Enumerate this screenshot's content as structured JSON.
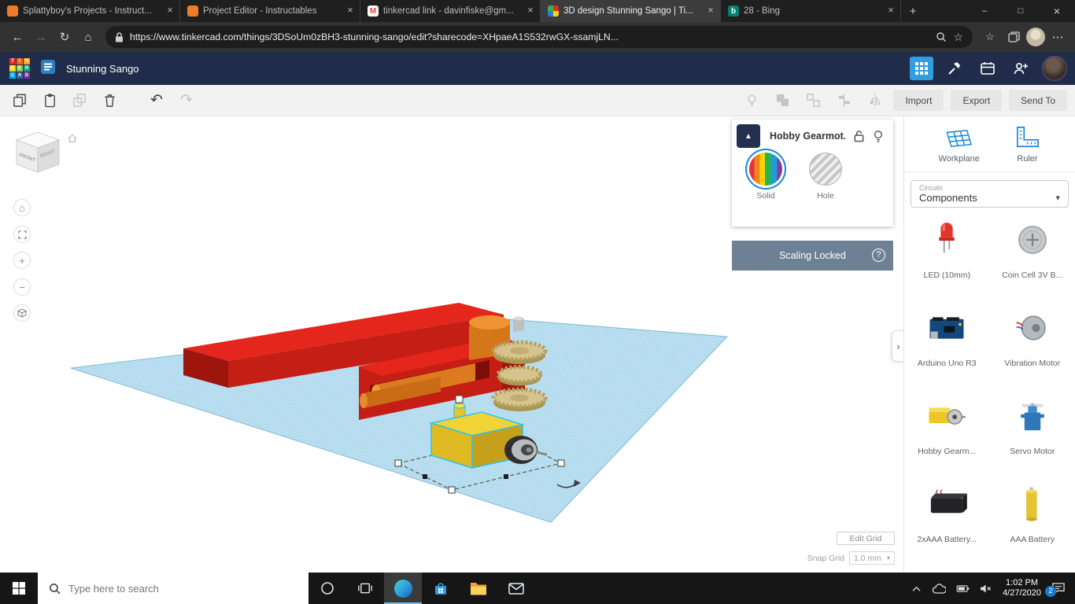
{
  "colors": {
    "accent_blue": "#1789d6",
    "selection_cyan": "#29c3f2",
    "workplane_blue": "#badff0",
    "shape_red": "#e5261c",
    "navbar_navy": "#202c49"
  },
  "browser": {
    "tabs": [
      {
        "title": "Splattyboy's Projects - Instruct..."
      },
      {
        "title": "Project Editor - Instructables"
      },
      {
        "title": "tinkercad link - davinfiske@gm..."
      },
      {
        "title": "3D design Stunning Sango | Ti..."
      },
      {
        "title": "28 - Bing"
      }
    ],
    "url": "https://www.tinkercad.com/things/3DSoUm0zBH3-stunning-sango/edit?sharecode=XHpaeA1S532rwGX-ssamjLN...",
    "glyphs": {
      "tab_close": "×",
      "new_tab": "+",
      "minimize": "–",
      "maximize": "□",
      "close": "×",
      "back": "←",
      "forward": "→",
      "refresh": "↻",
      "home": "⌂",
      "star": "☆",
      "menu": "⋯",
      "gmail_m": "M",
      "bing_b": "b"
    }
  },
  "app": {
    "logo_letters": [
      "T",
      "I",
      "N",
      "K",
      "E",
      "R",
      "C",
      "A",
      "D"
    ],
    "title": "Stunning Sango",
    "toolbar": {
      "import": "Import",
      "export": "Export",
      "send_to": "Send To"
    },
    "toolbar_glyphs": {
      "undo": "↶",
      "redo": "↷"
    },
    "viewcube": {
      "front": "FRONT",
      "right": "RIGHT"
    },
    "view_glyphs": {
      "home": "⌂",
      "zoom_in": "+",
      "zoom_out": "−"
    },
    "inspector": {
      "collapse": "▲",
      "title": "Hobby Gearmot...",
      "solid": "Solid",
      "hole": "Hole",
      "scaling": "Scaling Locked",
      "help": "?"
    },
    "panel_chevron": "›",
    "sidebar": {
      "workplane": "Workplane",
      "ruler": "Ruler",
      "category_group": "Circuits",
      "category": "Components",
      "caret": "▾",
      "components": [
        {
          "name": "LED (10mm)"
        },
        {
          "name": "Coin Cell 3V B..."
        },
        {
          "name": "Arduino Uno R3"
        },
        {
          "name": "Vibration Motor"
        },
        {
          "name": "Hobby Gearm..."
        },
        {
          "name": "Servo Motor"
        },
        {
          "name": "2xAAA Battery..."
        },
        {
          "name": "AAA Battery"
        }
      ]
    },
    "grid_footer": {
      "edit": "Edit Grid",
      "snap_label": "Snap Grid",
      "snap_value": "1.0 mm",
      "caret": "▾"
    }
  },
  "taskbar": {
    "search_placeholder": "Type here to search",
    "time": "1:02 PM",
    "date": "4/27/2020",
    "notification_count": "2"
  }
}
